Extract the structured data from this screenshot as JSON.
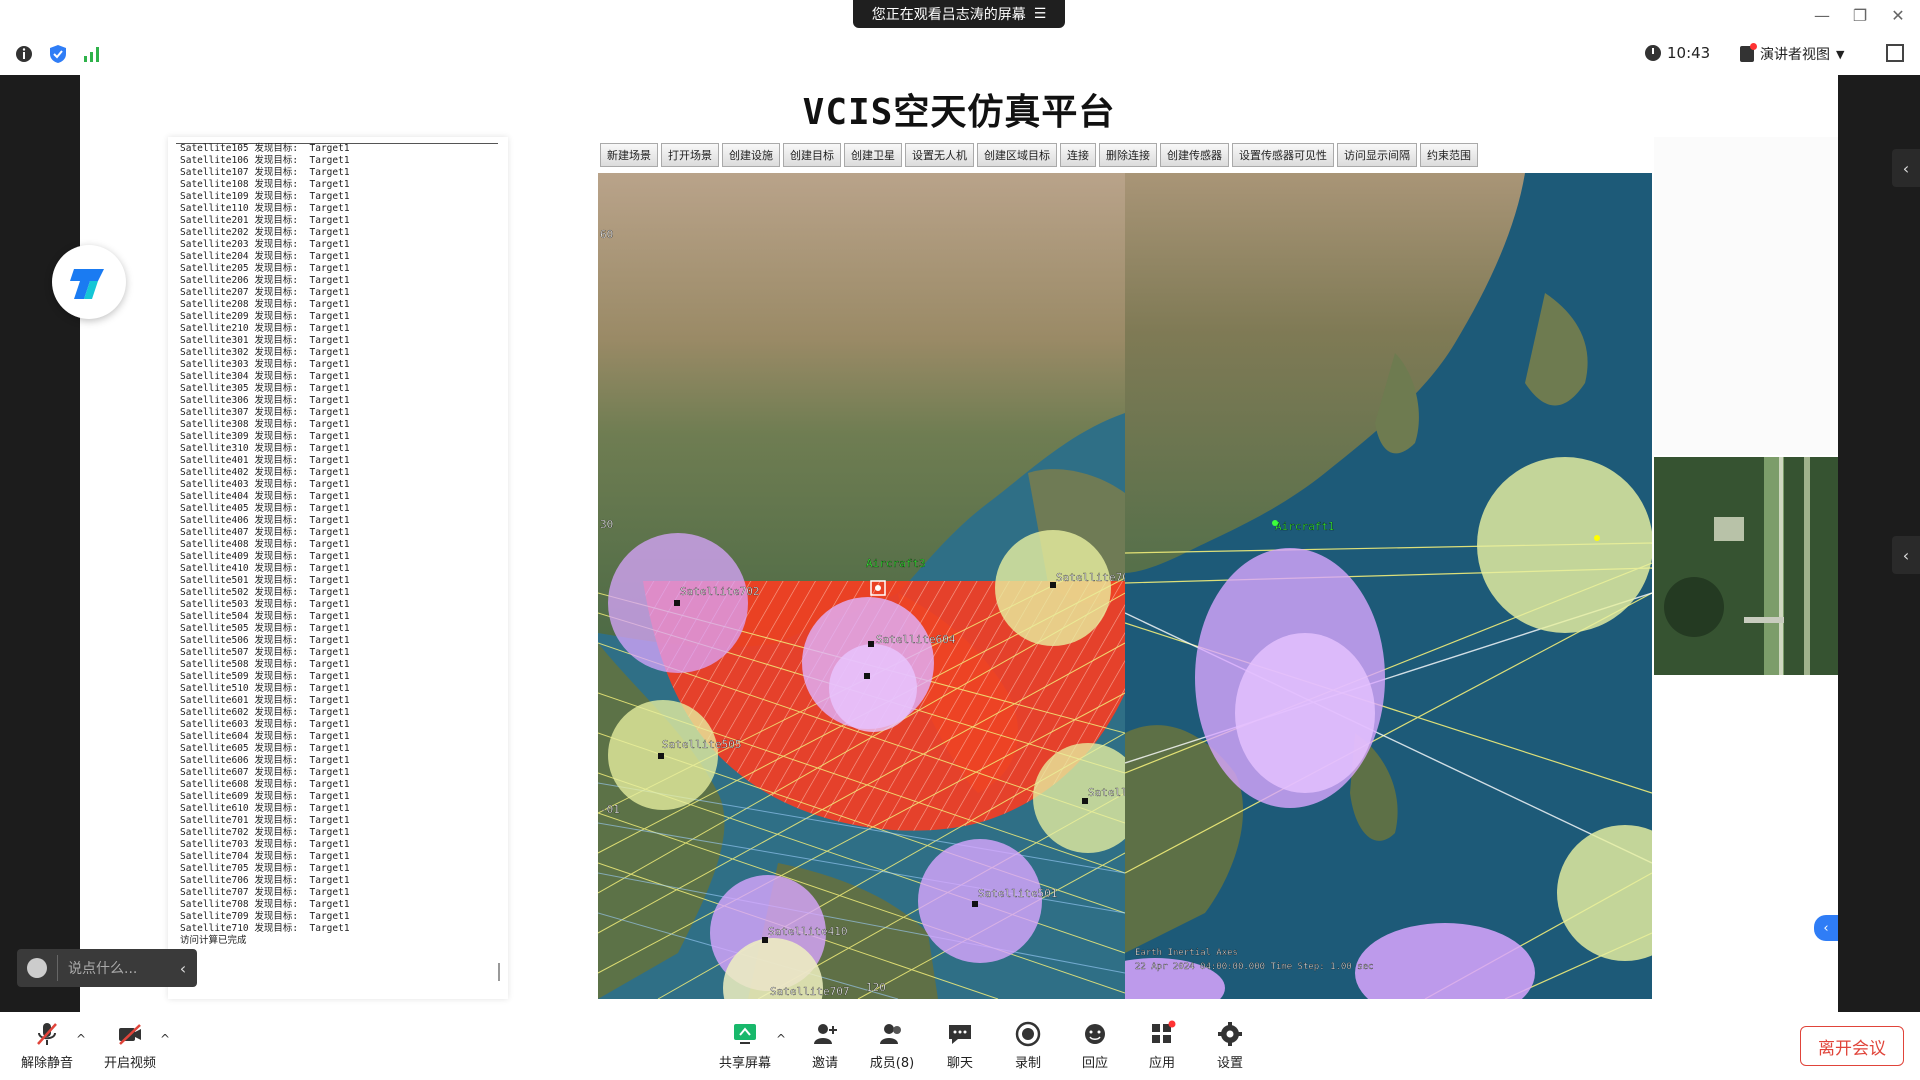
{
  "meeting": {
    "banner": "您正在观看吕志涛的屏幕",
    "banner_menu": "☰",
    "clock": "10:43",
    "view_mode": "演讲者视图",
    "window_controls": [
      "—",
      "❐",
      "✕"
    ]
  },
  "app": {
    "title": "VCIS空天仿真平台",
    "toolbar": [
      "新建场景",
      "打开场景",
      "创建设施",
      "创建目标",
      "创建卫星",
      "设置无人机",
      "创建区域目标",
      "连接",
      "删除连接",
      "创建传感器",
      "设置传感器可见性",
      "访问显示间隔",
      "约束范围"
    ],
    "log_lines": [
      "Satellite105 发现目标:  Target1",
      "Satellite106 发现目标:  Target1",
      "Satellite107 发现目标:  Target1",
      "Satellite108 发现目标:  Target1",
      "Satellite109 发现目标:  Target1",
      "Satellite110 发现目标:  Target1",
      "Satellite201 发现目标:  Target1",
      "Satellite202 发现目标:  Target1",
      "Satellite203 发现目标:  Target1",
      "Satellite204 发现目标:  Target1",
      "Satellite205 发现目标:  Target1",
      "Satellite206 发现目标:  Target1",
      "Satellite207 发现目标:  Target1",
      "Satellite208 发现目标:  Target1",
      "Satellite209 发现目标:  Target1",
      "Satellite210 发现目标:  Target1",
      "Satellite301 发现目标:  Target1",
      "Satellite302 发现目标:  Target1",
      "Satellite303 发现目标:  Target1",
      "Satellite304 发现目标:  Target1",
      "Satellite305 发现目标:  Target1",
      "Satellite306 发现目标:  Target1",
      "Satellite307 发现目标:  Target1",
      "Satellite308 发现目标:  Target1",
      "Satellite309 发现目标:  Target1",
      "Satellite310 发现目标:  Target1",
      "Satellite401 发现目标:  Target1",
      "Satellite402 发现目标:  Target1",
      "Satellite403 发现目标:  Target1",
      "Satellite404 发现目标:  Target1",
      "Satellite405 发现目标:  Target1",
      "Satellite406 发现目标:  Target1",
      "Satellite407 发现目标:  Target1",
      "Satellite408 发现目标:  Target1",
      "Satellite409 发现目标:  Target1",
      "Satellite410 发现目标:  Target1",
      "Satellite501 发现目标:  Target1",
      "Satellite502 发现目标:  Target1",
      "Satellite503 发现目标:  Target1",
      "Satellite504 发现目标:  Target1",
      "Satellite505 发现目标:  Target1",
      "Satellite506 发现目标:  Target1",
      "Satellite507 发现目标:  Target1",
      "Satellite508 发现目标:  Target1",
      "Satellite509 发现目标:  Target1",
      "Satellite510 发现目标:  Target1",
      "Satellite601 发现目标:  Target1",
      "Satellite602 发现目标:  Target1",
      "Satellite603 发现目标:  Target1",
      "Satellite604 发现目标:  Target1",
      "Satellite605 发现目标:  Target1",
      "Satellite606 发现目标:  Target1",
      "Satellite607 发现目标:  Target1",
      "Satellite608 发现目标:  Target1",
      "Satellite609 发现目标:  Target1",
      "Satellite610 发现目标:  Target1",
      "Satellite701 发现目标:  Target1",
      "Satellite702 发现目标:  Target1",
      "Satellite703 发现目标:  Target1",
      "Satellite704 发现目标:  Target1",
      "Satellite705 发现目标:  Target1",
      "Satellite706 发现目标:  Target1",
      "Satellite707 发现目标:  Target1",
      "Satellite708 发现目标:  Target1",
      "Satellite709 发现目标:  Target1",
      "Satellite710 发现目标:  Target1",
      "访问计算已完成"
    ],
    "map_labels": {
      "aircraft3": "Aircraft3",
      "sat702": "Satellite702",
      "sat703": "Satellite703",
      "sat604": "Satellite604",
      "sat505": "Satellite505",
      "sat501": "Satellite501",
      "sat410": "Satellite410",
      "sat_left_edge": "Satell",
      "sat707": "Satellite707",
      "aircraft1": "Aircraft1",
      "lat60": "60",
      "lat30": "30",
      "lat_n01": "-01",
      "lon120": "120",
      "right_caption1": "Earth Inertial Axes",
      "right_caption2": "22 Apr 2024 04:00:00.000    Time Step: 1.00 sec"
    }
  },
  "chat": {
    "placeholder": "说点什么..."
  },
  "bottombar": {
    "unmute": "解除静音",
    "video": "开启视频",
    "share": "共享屏幕",
    "invite": "邀请",
    "members": "成员(8)",
    "chat": "聊天",
    "record": "录制",
    "reply": "回应",
    "apps": "应用",
    "settings": "设置",
    "leave": "离开会议"
  },
  "colors": {
    "accent_blue": "#2f7df6",
    "leave_red": "#e0443a",
    "coverage_red": "#ff3b1f",
    "sensor_purple": "#d9a6ff",
    "sensor_yellow": "#e8f0a0"
  }
}
